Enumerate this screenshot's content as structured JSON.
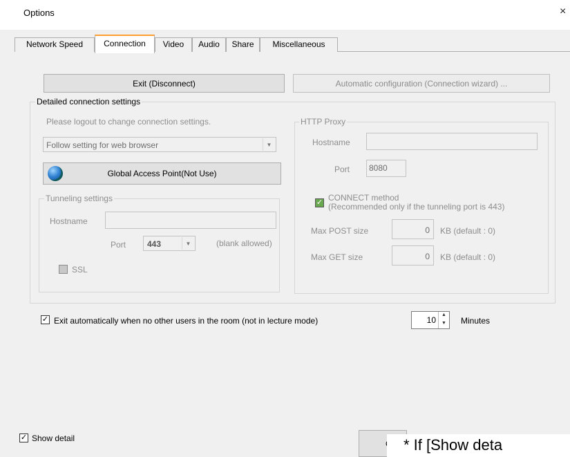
{
  "window": {
    "title": "Options",
    "close_glyph": "×"
  },
  "tabs": [
    {
      "label": "Network Speed"
    },
    {
      "label": "Connection"
    },
    {
      "label": "Video"
    },
    {
      "label": "Audio"
    },
    {
      "label": "Share"
    },
    {
      "label": "Miscellaneous"
    }
  ],
  "buttons": {
    "exit": "Exit (Disconnect)",
    "auto_config": "Automatic configuration (Connection wizard) ...",
    "global_access": "Global Access Point(Not Use)"
  },
  "detailed": {
    "legend": "Detailed connection settings",
    "logout_note": "Please logout to change connection settings.",
    "browser_combo": "Follow setting for web browser"
  },
  "tunneling": {
    "legend": "Tunneling settings",
    "hostname_label": "Hostname",
    "hostname_value": "",
    "port_label": "Port",
    "port_value": "443",
    "blank_note": "(blank allowed)",
    "ssl_label": "SSL"
  },
  "proxy": {
    "legend": "HTTP Proxy",
    "hostname_label": "Hostname",
    "hostname_value": "",
    "port_label": "Port",
    "port_value": "8080",
    "connect_line1": "CONNECT method",
    "connect_line2": "(Recommended only if the tunneling port is 443)",
    "max_post_label": "Max POST size",
    "max_post_value": "0",
    "max_post_unit": "KB (default : 0)",
    "max_get_label": "Max GET size",
    "max_get_value": "0",
    "max_get_unit": "KB (default : 0)"
  },
  "auto_exit": {
    "label": "Exit automatically when no other users in the room (not in lecture mode)",
    "minutes_value": "10",
    "minutes_label": "Minutes"
  },
  "footer": {
    "show_detail": "Show detail",
    "ok_partial": "C",
    "caption": "* If [Show deta"
  },
  "glyphs": {
    "check": "✓",
    "dropdown": "▼",
    "up": "▲",
    "down": "▼"
  },
  "icons": {
    "globe": "globe-icon"
  },
  "colors": {
    "active_tab_accent": "#ff9d2e",
    "check_green": "#6aa84f"
  }
}
